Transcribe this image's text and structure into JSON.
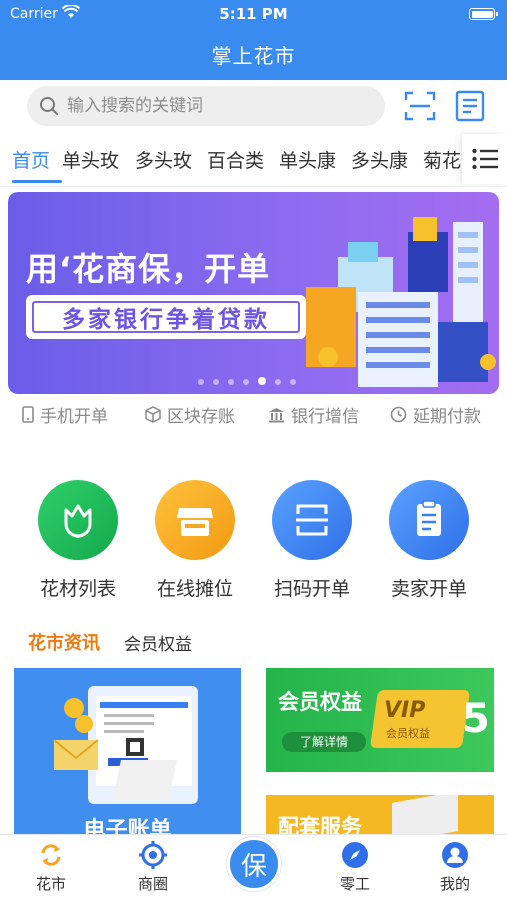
{
  "status_bar": {
    "carrier": "Carrier",
    "time": "5:11 PM"
  },
  "app": {
    "title": "掌上花市"
  },
  "search": {
    "placeholder": "输入搜索的关键词"
  },
  "category_tabs": [
    {
      "label": "首页",
      "active": true
    },
    {
      "label": "单头玫"
    },
    {
      "label": "多头玫"
    },
    {
      "label": "百合类"
    },
    {
      "label": "单头康"
    },
    {
      "label": "多头康"
    },
    {
      "label": "菊花"
    }
  ],
  "banner": {
    "slogan_main": "用‘花商保，开单",
    "slogan_sub": "多家银行争着贷款",
    "slide_count": 7,
    "active_slide": 4
  },
  "features": [
    {
      "icon": "phone-icon",
      "label": "手机开单"
    },
    {
      "icon": "cube-icon",
      "label": "区块存账"
    },
    {
      "icon": "bank-icon",
      "label": "银行增信"
    },
    {
      "icon": "clock-icon",
      "label": "延期付款"
    }
  ],
  "quick_actions": [
    {
      "icon": "flower-icon",
      "label": "花材列表",
      "color": "#1fb85a"
    },
    {
      "icon": "stall-icon",
      "label": "在线摊位",
      "color": "#f5a623"
    },
    {
      "icon": "scan-icon",
      "label": "扫码开单",
      "color": "#3a7ff0"
    },
    {
      "icon": "clipboard-icon",
      "label": "卖家开单",
      "color": "#3a7ff0"
    }
  ],
  "news": {
    "tab_active": "花市资讯",
    "tab_other": "会员权益"
  },
  "cards": {
    "left_title": "电子账单",
    "right_top_title": "会员权益",
    "right_top_button": "了解详情",
    "right_top_vip": "VIP",
    "right_top_vip_sub": "会员权益",
    "right_top_big": "5",
    "right_bottom_title": "配套服务"
  },
  "tabbar": [
    {
      "icon": "refresh-icon",
      "label": "花市"
    },
    {
      "icon": "target-icon",
      "label": "商圈"
    },
    {
      "icon": "center-icon",
      "label": "保"
    },
    {
      "icon": "compass-icon",
      "label": "零工"
    },
    {
      "icon": "user-icon",
      "label": "我的"
    }
  ],
  "colors": {
    "primary": "#3a8bf0",
    "orange": "#f07a10",
    "green": "#1fb85a",
    "yellow": "#f5a623"
  }
}
